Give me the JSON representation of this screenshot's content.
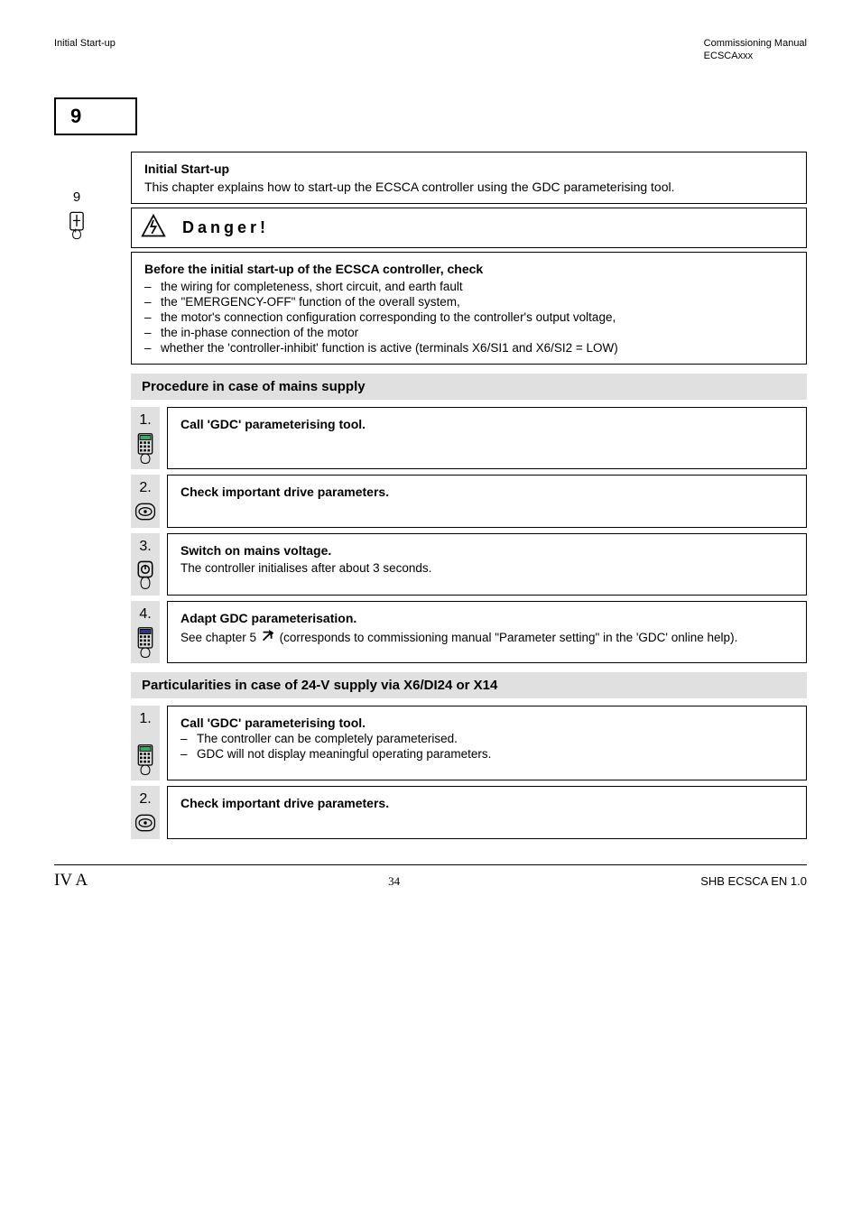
{
  "header": {
    "chapter": "Initial Start-up",
    "doctype": "Commissioning Manual",
    "model": "ECSCAxxx"
  },
  "tab": {
    "label": "9"
  },
  "intro_num": "9",
  "intro": {
    "title": "Initial Start-up",
    "body": "This chapter explains how to start-up the ECSCA controller using the GDC parameterising tool."
  },
  "danger": {
    "label": "Danger!"
  },
  "safetybox": {
    "title": "Before the initial start-up of the ECSCA controller, check",
    "b1": "the wiring for completeness, short circuit, and earth fault",
    "b2": "the \"EMERGENCY-OFF\" function of the overall system,",
    "b3": "the motor's connection configuration corresponding to the controller's output voltage,",
    "b4": "the in-phase connection of the motor",
    "b5": "whether the 'controller-inhibit' function is active (terminals X6/SI1 and X6/SI2 = LOW)"
  },
  "sectionA": {
    "heading": "Procedure in case of mains supply",
    "s1": {
      "num": "1.",
      "title": "Call 'GDC' parameterising tool."
    },
    "s2": {
      "num": "2.",
      "title": "Check important drive parameters."
    },
    "s3": {
      "num": "3.",
      "title": "Switch on mains voltage.",
      "sub": "The controller initialises after about 3 seconds."
    },
    "s4": {
      "num": "4.",
      "title": "Adapt GDC parameterisation.",
      "sub_pre": "See chapter 5",
      "sub_post": "(corresponds to commissioning manual \"Parameter setting\" in the 'GDC' online help)."
    }
  },
  "sectionB": {
    "heading": "Particularities in case of 24-V supply via X6/DI24 or X14",
    "s1": {
      "num": "1.",
      "title": "Call 'GDC' parameterising tool.",
      "sub": "The controller can be completely parameterised.",
      "sub2": "GDC will not display meaningful operating parameters."
    },
    "s2": {
      "num": "2.",
      "title": "Check important drive parameters."
    }
  },
  "footer": {
    "left": "IV A",
    "mid": "34",
    "right": "SHB ECSCA EN 1.0"
  }
}
